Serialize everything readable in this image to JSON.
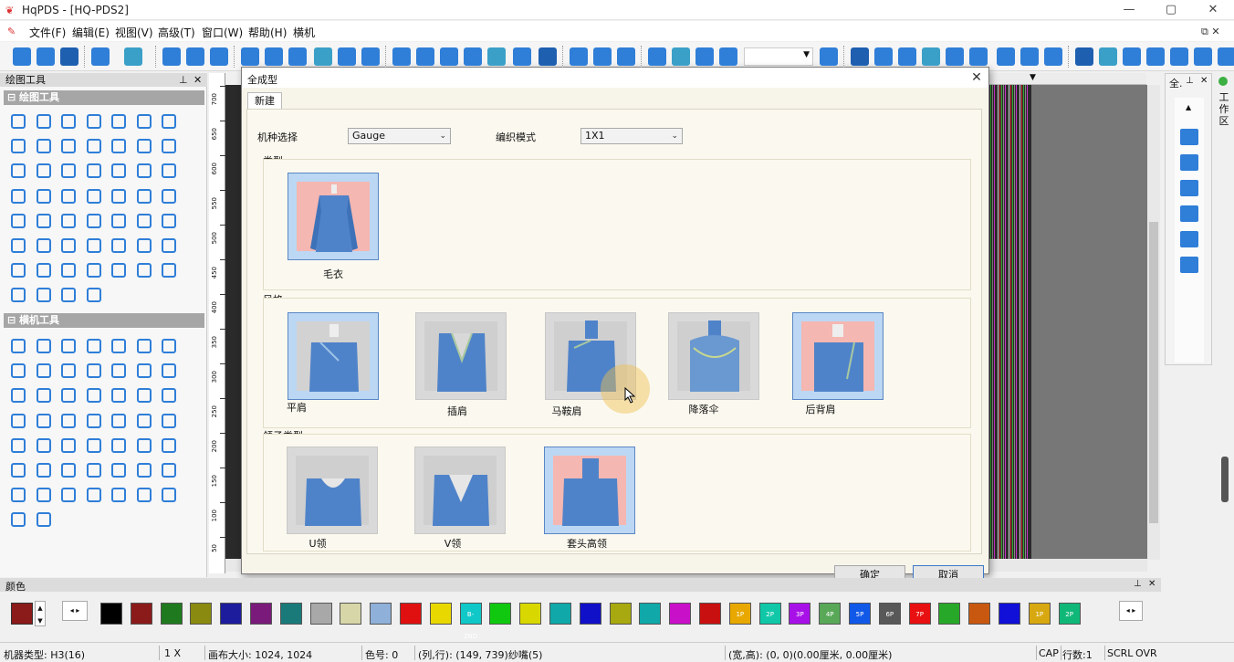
{
  "window": {
    "app_title": "HqPDS - [HQ-PDS2]",
    "logo_text": "❦"
  },
  "menu": {
    "items": [
      "文件(F)",
      "编辑(E)",
      "视图(V)",
      "高级(T)",
      "窗口(W)",
      "帮助(H)",
      "横机"
    ],
    "mdi_controls": "⧉ ✕"
  },
  "left_panel": {
    "title": "绘图工具",
    "section_drawing": "⊟ 绘图工具",
    "section_machine": "⊟ 横机工具"
  },
  "right_panel": {
    "tab_label": "全.",
    "side_label": "工作区"
  },
  "dialog": {
    "title": "全成型",
    "tab": "新建",
    "machine_label": "机种选择",
    "machine_value": "Gauge",
    "knit_label": "编织模式",
    "knit_value": "1X1",
    "group_type": "类型",
    "group_style": "风格",
    "group_collar": "领子类型",
    "type_items": [
      {
        "label": "毛衣",
        "selected": true
      }
    ],
    "style_items": [
      {
        "label": "平肩",
        "selected": true
      },
      {
        "label": "插肩",
        "selected": false
      },
      {
        "label": "马鞍肩",
        "selected": false
      },
      {
        "label": "降落伞",
        "selected": false
      },
      {
        "label": "后背肩",
        "selected": true
      }
    ],
    "collar_items": [
      {
        "label": "U领",
        "selected": false
      },
      {
        "label": "V领",
        "selected": false
      },
      {
        "label": "套头高领",
        "selected": true
      }
    ],
    "ok": "确定",
    "cancel": "取消",
    "close": "✕"
  },
  "ruler_ticks": [
    "700",
    "650",
    "600",
    "550",
    "500",
    "450",
    "400",
    "350",
    "300",
    "250",
    "200",
    "150",
    "100",
    "50"
  ],
  "colors": {
    "title": "颜色",
    "swatches": [
      {
        "bg": "#000000",
        "label": ""
      },
      {
        "bg": "#8b1a1a",
        "label": ""
      },
      {
        "bg": "#1f7a1f",
        "label": ""
      },
      {
        "bg": "#8a8a10",
        "label": ""
      },
      {
        "bg": "#1c1c9c",
        "label": ""
      },
      {
        "bg": "#7a1a7a",
        "label": ""
      },
      {
        "bg": "#1a7a7a",
        "label": ""
      },
      {
        "bg": "#a8a8a8",
        "label": ""
      },
      {
        "bg": "#d6d6a8",
        "label": ""
      },
      {
        "bg": "#8fb0d8",
        "label": ""
      },
      {
        "bg": "#e01010",
        "label": ""
      },
      {
        "bg": "#e8d800",
        "label": ""
      },
      {
        "bg": "#10c8c8",
        "label": "B-2ND"
      },
      {
        "bg": "#10c810",
        "label": ""
      },
      {
        "bg": "#d8d800",
        "label": ""
      },
      {
        "bg": "#10a8a8",
        "label": ""
      },
      {
        "bg": "#1010c8",
        "label": ""
      },
      {
        "bg": "#a8a810",
        "label": ""
      },
      {
        "bg": "#10a8a8",
        "label": ""
      },
      {
        "bg": "#c810c8",
        "label": ""
      },
      {
        "bg": "#c81010",
        "label": ""
      },
      {
        "bg": "#e8a800",
        "label": "1P"
      },
      {
        "bg": "#10c8a8",
        "label": "2P"
      },
      {
        "bg": "#a810e8",
        "label": "3P"
      },
      {
        "bg": "#58a858",
        "label": "4P"
      },
      {
        "bg": "#1058e8",
        "label": "5P"
      },
      {
        "bg": "#585858",
        "label": "6P"
      },
      {
        "bg": "#e81010",
        "label": "7P"
      },
      {
        "bg": "#28a828",
        "label": ""
      },
      {
        "bg": "#c85810",
        "label": ""
      },
      {
        "bg": "#1010d8",
        "label": ""
      },
      {
        "bg": "#d8a810",
        "label": "1P"
      },
      {
        "bg": "#10b878",
        "label": "2P"
      }
    ]
  },
  "status": {
    "machine_type": "机器类型: H3(16)",
    "zoom": "1 X",
    "canvas_size": "画布大小: 1024, 1024",
    "color_no": "色号: 0",
    "col_row": "(列,行): (149, 739)纱嘴(5)",
    "size": "(宽,高): (0, 0)(0.00厘米, 0.00厘米)",
    "cap": "CAP",
    "row_count": "行数:1",
    "scrl": "SCRL",
    "ovr": "OVR"
  }
}
